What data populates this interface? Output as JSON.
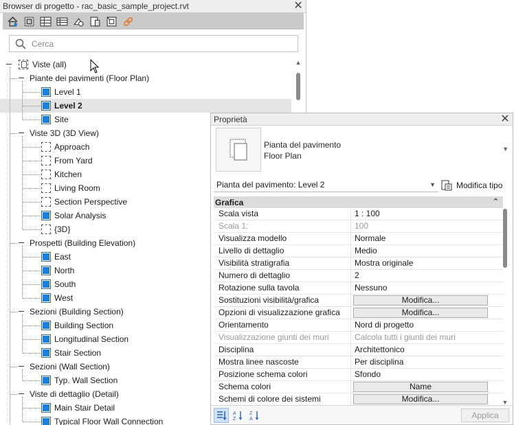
{
  "browser": {
    "title": "Browser di progetto - rac_basic_sample_project.rvt",
    "close": "✕",
    "toolbar_icons": [
      "home-icon",
      "zoom-fit-icon",
      "schedule-icon",
      "sheet-icon",
      "family-icon",
      "group-icon",
      "link-icon",
      "revit-link-icon"
    ],
    "search_placeholder": "Cerca",
    "tree": [
      {
        "label": "Viste (all)",
        "level": 0,
        "type": "root",
        "icon": "all"
      },
      {
        "label": "Piante dei pavimenti (Floor Plan)",
        "level": 1,
        "type": "group"
      },
      {
        "label": "Level 1",
        "level": 2,
        "type": "leaf",
        "icon": "plan"
      },
      {
        "label": "Level 2",
        "level": 2,
        "type": "leaf",
        "icon": "plan",
        "selected": true
      },
      {
        "label": "Site",
        "level": 2,
        "type": "leaf",
        "icon": "plan"
      },
      {
        "label": "Viste 3D (3D View)",
        "level": 1,
        "type": "group"
      },
      {
        "label": "Approach",
        "level": 2,
        "type": "leaf",
        "icon": "view3d"
      },
      {
        "label": "From Yard",
        "level": 2,
        "type": "leaf",
        "icon": "view3d"
      },
      {
        "label": "Kitchen",
        "level": 2,
        "type": "leaf",
        "icon": "view3d"
      },
      {
        "label": "Living Room",
        "level": 2,
        "type": "leaf",
        "icon": "view3d"
      },
      {
        "label": "Section Perspective",
        "level": 2,
        "type": "leaf",
        "icon": "view3d"
      },
      {
        "label": "Solar Analysis",
        "level": 2,
        "type": "leaf",
        "icon": "plan"
      },
      {
        "label": "{3D}",
        "level": 2,
        "type": "leaf",
        "icon": "view3d"
      },
      {
        "label": "Prospetti (Building Elevation)",
        "level": 1,
        "type": "group"
      },
      {
        "label": "East",
        "level": 2,
        "type": "leaf",
        "icon": "plan"
      },
      {
        "label": "North",
        "level": 2,
        "type": "leaf",
        "icon": "plan"
      },
      {
        "label": "South",
        "level": 2,
        "type": "leaf",
        "icon": "plan"
      },
      {
        "label": "West",
        "level": 2,
        "type": "leaf",
        "icon": "plan"
      },
      {
        "label": "Sezioni (Building Section)",
        "level": 1,
        "type": "group"
      },
      {
        "label": "Building Section",
        "level": 2,
        "type": "leaf",
        "icon": "plan"
      },
      {
        "label": "Longitudinal Section",
        "level": 2,
        "type": "leaf",
        "icon": "plan"
      },
      {
        "label": "Stair Section",
        "level": 2,
        "type": "leaf",
        "icon": "plan"
      },
      {
        "label": "Sezioni (Wall Section)",
        "level": 1,
        "type": "group"
      },
      {
        "label": "Typ. Wall Section",
        "level": 2,
        "type": "leaf",
        "icon": "plan"
      },
      {
        "label": "Viste di dettaglio (Detail)",
        "level": 1,
        "type": "group"
      },
      {
        "label": "Main Stair Detail",
        "level": 2,
        "type": "leaf",
        "icon": "plan"
      },
      {
        "label": "Typical Floor Wall Connection",
        "level": 2,
        "type": "leaf",
        "icon": "plan"
      }
    ]
  },
  "properties": {
    "title": "Proprietà",
    "close": "✕",
    "type_line1": "Pianta del pavimento",
    "type_line2": "Floor Plan",
    "instance_selector": "Pianta del pavimento: Level 2",
    "edit_type": "Modifica tipo",
    "section": "Grafica",
    "rows": [
      {
        "name": "Scala vista",
        "value": "1 : 100",
        "kind": "text"
      },
      {
        "name": "Scala  1:",
        "value": "100",
        "kind": "text",
        "dim": true
      },
      {
        "name": "Visualizza modello",
        "value": "Normale",
        "kind": "text"
      },
      {
        "name": "Livello di dettaglio",
        "value": "Medio",
        "kind": "text"
      },
      {
        "name": "Visibilità stratigrafia",
        "value": "Mostra originale",
        "kind": "text"
      },
      {
        "name": "Numero di dettaglio",
        "value": "2",
        "kind": "text"
      },
      {
        "name": "Rotazione sulla tavola",
        "value": "Nessuno",
        "kind": "text"
      },
      {
        "name": "Sostituzioni visibilità/grafica",
        "value": "Modifica...",
        "kind": "button"
      },
      {
        "name": "Opzioni di visualizzazione grafica",
        "value": "Modifica...",
        "kind": "button"
      },
      {
        "name": "Orientamento",
        "value": "Nord di progetto",
        "kind": "text"
      },
      {
        "name": "Visualizzazione giunti dei muri",
        "value": "Calcola tutti i giunti dei muri",
        "kind": "text",
        "dim": true
      },
      {
        "name": "Disciplina",
        "value": "Architettonico",
        "kind": "text"
      },
      {
        "name": "Mostra linee nascoste",
        "value": "Per disciplina",
        "kind": "text"
      },
      {
        "name": "Posizione schema colori",
        "value": "Sfondo",
        "kind": "text"
      },
      {
        "name": "Schema colori",
        "value": "Name",
        "kind": "button"
      },
      {
        "name": "Schemi di colore dei sistemi",
        "value": "Modifica...",
        "kind": "button"
      }
    ],
    "apply": "Applica"
  }
}
